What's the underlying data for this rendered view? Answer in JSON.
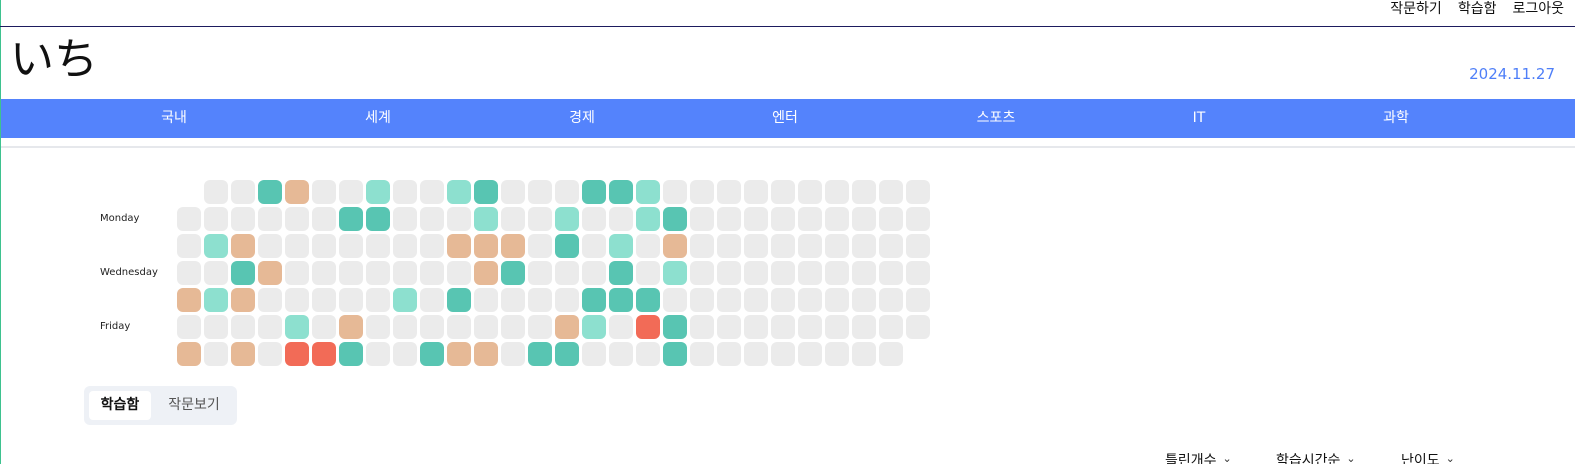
{
  "header": {
    "links": [
      "작문하기",
      "학습함",
      "로그아웃"
    ],
    "logo": "いち",
    "date": "2024.11.27"
  },
  "nav": {
    "items": [
      "국내",
      "세계",
      "경제",
      "엔터",
      "스포츠",
      "IT",
      "과학"
    ]
  },
  "heatmap": {
    "day_labels": [
      "Monday",
      "Wednesday",
      "Friday"
    ],
    "colors": {
      "0": "#ebebeb",
      "1": "#8de0cf",
      "2": "#58c5b2",
      "3": "#e6b996",
      "4": "#f26b57"
    },
    "weeks": [
      [
        null,
        0,
        0,
        0,
        3,
        0,
        3
      ],
      [
        0,
        0,
        1,
        0,
        1,
        0,
        0
      ],
      [
        0,
        0,
        3,
        2,
        3,
        0,
        3
      ],
      [
        2,
        0,
        0,
        3,
        0,
        0,
        0
      ],
      [
        3,
        0,
        0,
        0,
        0,
        1,
        4
      ],
      [
        0,
        0,
        0,
        0,
        0,
        0,
        4
      ],
      [
        0,
        2,
        0,
        0,
        0,
        3,
        2
      ],
      [
        1,
        2,
        0,
        0,
        0,
        0,
        0
      ],
      [
        0,
        0,
        0,
        0,
        1,
        0,
        0
      ],
      [
        0,
        0,
        0,
        0,
        0,
        0,
        2
      ],
      [
        1,
        0,
        3,
        0,
        2,
        0,
        3
      ],
      [
        2,
        1,
        3,
        3,
        0,
        0,
        3
      ],
      [
        0,
        0,
        3,
        2,
        0,
        0,
        0
      ],
      [
        0,
        0,
        0,
        0,
        0,
        0,
        2
      ],
      [
        0,
        1,
        2,
        0,
        0,
        3,
        2
      ],
      [
        2,
        0,
        0,
        0,
        2,
        1,
        0
      ],
      [
        2,
        0,
        1,
        2,
        2,
        0,
        0
      ],
      [
        1,
        1,
        0,
        0,
        2,
        4,
        0
      ],
      [
        0,
        2,
        3,
        1,
        0,
        2,
        2
      ],
      [
        0,
        0,
        0,
        0,
        0,
        0,
        0
      ],
      [
        0,
        0,
        0,
        0,
        0,
        0,
        0
      ],
      [
        0,
        0,
        0,
        0,
        0,
        0,
        0
      ],
      [
        0,
        0,
        0,
        0,
        0,
        0,
        0
      ],
      [
        0,
        0,
        0,
        0,
        0,
        0,
        0
      ],
      [
        0,
        0,
        0,
        0,
        0,
        0,
        0
      ],
      [
        0,
        0,
        0,
        0,
        0,
        0,
        0
      ],
      [
        0,
        0,
        0,
        0,
        0,
        0,
        0
      ],
      [
        0,
        0,
        0,
        0,
        0,
        0,
        null
      ]
    ]
  },
  "tabs": [
    "학습함",
    "작문보기"
  ],
  "filters": [
    {
      "label": "틀린개수",
      "icon": "chevron-down-icon"
    },
    {
      "label": "학습시간순",
      "icon": "chevron-down-icon"
    },
    {
      "label": "난이도",
      "icon": "chevron-down-icon"
    }
  ]
}
